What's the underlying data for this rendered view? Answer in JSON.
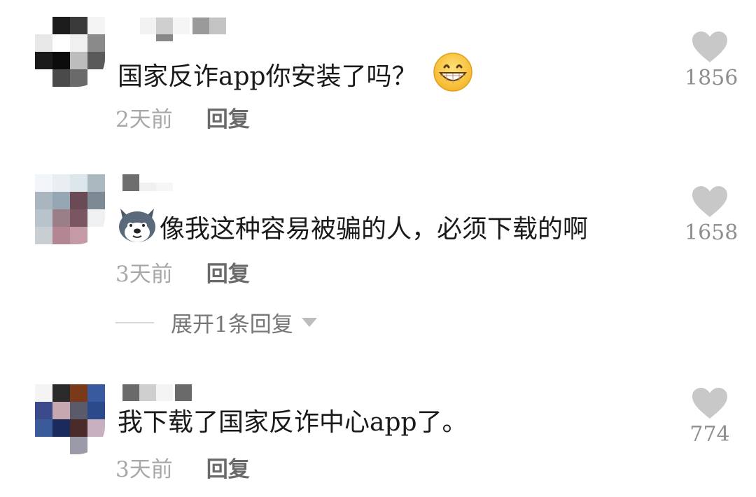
{
  "comments": [
    {
      "text": "国家反诈app你安装了吗？",
      "time": "2天前",
      "reply": "回复",
      "likes": "1856",
      "emoji": "grinning-face-icon"
    },
    {
      "text": "像我这种容易被骗的人，必须下载的啊",
      "time": "3天前",
      "reply": "回复",
      "likes": "1658",
      "emoji": "doge-icon",
      "expand_label": "展开1条回复"
    },
    {
      "text": "我下载了国家反诈中心app了。",
      "time": "3天前",
      "reply": "回复",
      "likes": "774"
    }
  ],
  "icons": {
    "like": "heart-icon",
    "expand": "triangle-down-icon"
  },
  "colors": {
    "heart": "#c8c8c8",
    "like_count": "#8f8f8f",
    "time": "#a8a8a8",
    "reply": "#6a6a6a"
  }
}
